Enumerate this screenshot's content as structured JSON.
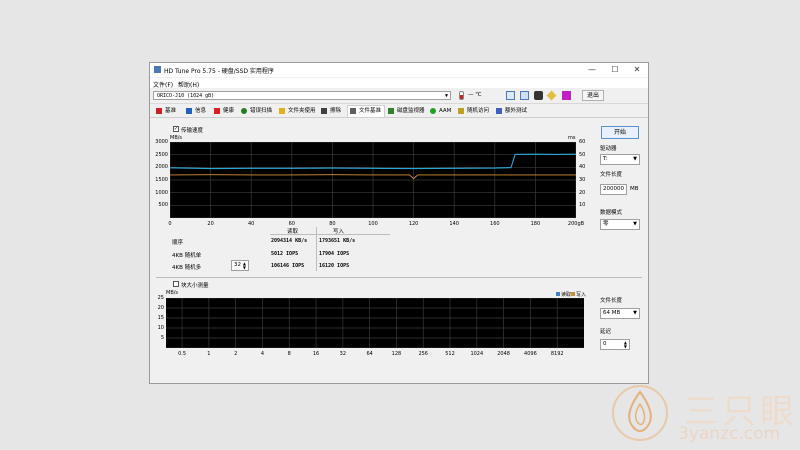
{
  "window": {
    "title": "HD Tune Pro 5.75 - 硬盘/SSD 实用程序",
    "controls": {
      "minimize": "—",
      "maximize": "☐",
      "close": "✕"
    }
  },
  "menu": [
    "文件(F)",
    "帮助(H)"
  ],
  "toolbar": {
    "drive": "ORICO-J10 (1024 gB)",
    "temperature": "— ℃",
    "exit_label": "退出",
    "icons": [
      "thermometer-icon",
      "copy-icon",
      "copy-all-icon",
      "camera-icon",
      "options-icon",
      "save-icon"
    ]
  },
  "tabs": [
    {
      "label": "基准",
      "icon": "benchmark-icon",
      "color": "#d02020"
    },
    {
      "label": "信息",
      "icon": "info-icon",
      "color": "#2060c0"
    },
    {
      "label": "健康",
      "icon": "health-icon",
      "color": "#e02020"
    },
    {
      "label": "错误扫描",
      "icon": "error-scan-icon",
      "color": "#208020"
    },
    {
      "label": "文件夹使用",
      "icon": "folder-icon",
      "color": "#e0b020"
    },
    {
      "label": "擦除",
      "icon": "erase-icon",
      "color": "#404040"
    },
    {
      "label": "文件基准",
      "icon": "file-benchmark-icon",
      "color": "#404040"
    },
    {
      "label": "磁盘监视器",
      "icon": "disk-monitor-icon",
      "color": "#308030"
    },
    {
      "label": "AAM",
      "icon": "aam-icon",
      "color": "#20a020"
    },
    {
      "label": "随机访问",
      "icon": "random-access-icon",
      "color": "#c0a020"
    },
    {
      "label": "额外测试",
      "icon": "extra-tests-icon",
      "color": "#4060c0"
    }
  ],
  "active_tab": "文件基准",
  "transfer": {
    "checkbox_label": "传输速度",
    "checked": true,
    "left_unit": "MB/s",
    "right_unit": "ms",
    "x_unit": "gB"
  },
  "results": {
    "headers": {
      "read": "读取",
      "write": "写入"
    },
    "rows": [
      {
        "label": "顺序",
        "read": "2094314 KB/s",
        "write": "1793651 KB/s"
      },
      {
        "label": "4KB 随机单",
        "read": "5012 IOPS",
        "write": "17904 IOPS"
      },
      {
        "label": "4KB 随机多",
        "read": "106146 IOPS",
        "write": "16120 IOPS"
      }
    ],
    "queue_depth": "32"
  },
  "block_size": {
    "checkbox_label": "块大小测量",
    "checked": false,
    "unit": "MB/s",
    "legend": [
      {
        "label": "读取",
        "color": "#3a7fd0"
      },
      {
        "label": "写入",
        "color": "#d08a30"
      }
    ]
  },
  "side_panel": {
    "start_label": "开始",
    "drive_label": "驱动器",
    "drive_value": "T:",
    "file_length_label": "文件长度",
    "file_length_value": "200000",
    "file_length_unit": "MB",
    "data_mode_label": "数据模式",
    "data_mode_value": "零"
  },
  "side_panel2": {
    "file_length_label": "文件长度",
    "file_length_value": "64 MB",
    "delay_label": "延迟",
    "delay_value": "0"
  },
  "watermark": {
    "logo_text": "三只眼",
    "url": "3yanzc.com"
  },
  "colors": {
    "read_line": "#28a8d8",
    "write_line": "#d89038",
    "grid": "#3a3a3a"
  },
  "chart_data": [
    {
      "type": "line",
      "title": "",
      "xlabel": "gB",
      "ylabel": "MB/s",
      "y2label": "ms",
      "xlim": [
        0,
        200
      ],
      "ylim": [
        0,
        3000
      ],
      "y2lim": [
        0,
        60
      ],
      "x_ticks": [
        "0",
        "20",
        "40",
        "60",
        "80",
        "100",
        "120",
        "140",
        "160",
        "180",
        "200gB"
      ],
      "y_ticks": [
        "3000",
        "2500",
        "2000",
        "1500",
        "1000",
        "500"
      ],
      "y2_ticks": [
        "60",
        "50",
        "40",
        "30",
        "20",
        "10"
      ],
      "series": [
        {
          "values_x": [
            0,
            20,
            40,
            60,
            80,
            100,
            120,
            140,
            160,
            168,
            170,
            180,
            190,
            200
          ],
          "values_y": [
            1980,
            1950,
            1960,
            1960,
            1970,
            1960,
            1950,
            1960,
            1970,
            1990,
            2510,
            2520,
            2510,
            2520
          ]
        },
        {
          "values_x": [
            0,
            20,
            40,
            60,
            80,
            100,
            118,
            120,
            122,
            140,
            160,
            180,
            200
          ],
          "values_y": [
            1700,
            1710,
            1700,
            1700,
            1710,
            1700,
            1700,
            1550,
            1700,
            1700,
            1700,
            1700,
            1700
          ]
        }
      ],
      "grid": true
    },
    {
      "type": "bar",
      "xlabel": "",
      "ylabel": "MB/s",
      "categories": [
        "0.5",
        "1",
        "2",
        "4",
        "8",
        "16",
        "32",
        "64",
        "128",
        "256",
        "512",
        "1024",
        "2048",
        "4096",
        "8192"
      ],
      "y_ticks": [
        "25",
        "20",
        "15",
        "10",
        "5"
      ],
      "ylim": [
        0,
        25
      ],
      "series": [
        {
          "name": "读取",
          "values": []
        },
        {
          "name": "写入",
          "values": []
        }
      ],
      "grid": true
    }
  ]
}
